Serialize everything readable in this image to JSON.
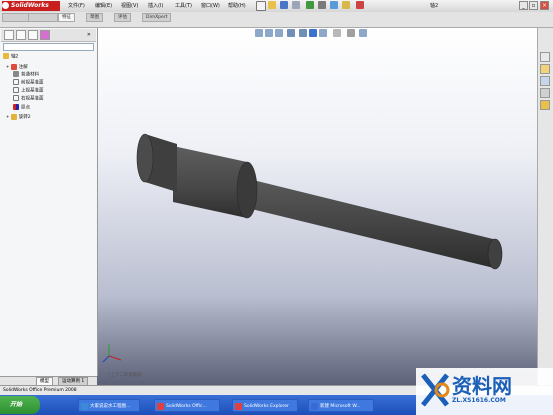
{
  "app": {
    "logo_text": "SolidWorks",
    "document_title": "轴2"
  },
  "menu": [
    "文件(F)",
    "编辑(E)",
    "视图(V)",
    "插入(I)",
    "工具(T)",
    "窗口(W)",
    "帮助(H)"
  ],
  "command_tabs": [
    "特征",
    "草图",
    "评估",
    "DimXpert"
  ],
  "feature_tree": {
    "root": "轴2",
    "items": [
      "注解",
      "普通材料",
      "前视基准面",
      "上视基准面",
      "右视基准面",
      "原点",
      "旋转2"
    ]
  },
  "panel_tabs": [
    "模型",
    "运动算例 1"
  ],
  "viewport": {
    "view_label": "*上下二等角轴测"
  },
  "status": {
    "text": "SolidWorks Office Premium 2008"
  },
  "taskbar": {
    "start_label": "开始",
    "tasks": [
      "大家说说水工程图...",
      "SolidWorks Offic...",
      "SolidWorks Explorer",
      "新建 Microsoft W..."
    ]
  },
  "watermark": {
    "site": "资料网",
    "url": "ZL.XS1616.COM"
  },
  "colors": {
    "accent_red": "#c81e1e",
    "taskbar_blue": "#2458c8",
    "shaft": "#4a4a4a"
  }
}
